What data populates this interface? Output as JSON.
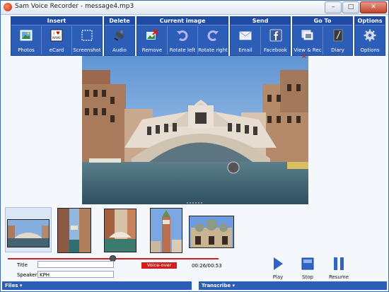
{
  "window": {
    "title": "Sam Voice Recorder - message4.mp3",
    "controls": {
      "minimize": "–",
      "maximize": "□",
      "close": "✕"
    }
  },
  "ribbon": {
    "groups": [
      {
        "header": "Insert",
        "tools": [
          {
            "label": "Photos",
            "icon": "photo-icon"
          },
          {
            "label": "eCard",
            "icon": "ecard-icon"
          },
          {
            "label": "Screenshot",
            "icon": "screenshot-icon"
          }
        ]
      },
      {
        "header": "Delete",
        "tools": [
          {
            "label": "Audio",
            "icon": "delete-audio-icon"
          }
        ]
      },
      {
        "header": "Current image",
        "tools": [
          {
            "label": "Remove",
            "icon": "remove-image-icon"
          },
          {
            "label": "Rotate left",
            "icon": "rotate-left-icon"
          },
          {
            "label": "Rotate right",
            "icon": "rotate-right-icon"
          }
        ]
      },
      {
        "header": "Send",
        "tools": [
          {
            "label": "Email",
            "icon": "email-icon"
          },
          {
            "label": "Facebook",
            "icon": "facebook-icon"
          }
        ]
      },
      {
        "header": "Go To",
        "tools": [
          {
            "label": "View & Rec",
            "icon": "view-rec-icon"
          },
          {
            "label": "Diary",
            "icon": "diary-icon"
          }
        ]
      },
      {
        "header": "Options",
        "tools": [
          {
            "label": "Options",
            "icon": "gear-icon"
          }
        ]
      }
    ],
    "ecard_mark": {
      "heart_line": "I ♥",
      "name_line": "NAME"
    }
  },
  "viewer": {
    "close_glyph": "✕"
  },
  "controls": {
    "title_label": "Title",
    "title_value": "",
    "speaker_label": "Speaker",
    "speaker_value": "KPH",
    "voice_over": "Voice-over",
    "time": "00:26/00:53",
    "play_label": "Play",
    "stop_label": "Stop",
    "resume_label": "Resume"
  },
  "bottom": {
    "files_label": "Files ▾",
    "transcribe_label": "Transcribe ▾"
  },
  "colors": {
    "ribbon_blue": "#2c5eb8",
    "accent_red": "#d51c1c",
    "play_blue": "#2f63c8"
  }
}
